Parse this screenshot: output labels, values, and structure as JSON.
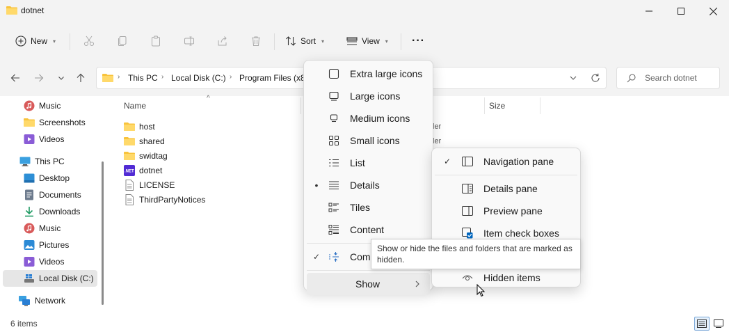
{
  "window": {
    "title": "dotnet"
  },
  "toolbar": {
    "new_label": "New",
    "sort_label": "Sort",
    "view_label": "View",
    "more_label": "···"
  },
  "address": {
    "crumbs": [
      "This PC",
      "Local Disk (C:)",
      "Program Files (x8"
    ],
    "search_placeholder": "Search dotnet"
  },
  "sidebar": {
    "items": [
      {
        "label": "Music",
        "icon": "music-icon",
        "indent": 1
      },
      {
        "label": "Screenshots",
        "icon": "folder-icon",
        "indent": 1
      },
      {
        "label": "Videos",
        "icon": "videos-icon",
        "indent": 1
      },
      {
        "label": "This PC",
        "icon": "computer-icon",
        "indent": 0
      },
      {
        "label": "Desktop",
        "icon": "desktop-icon",
        "indent": 1
      },
      {
        "label": "Documents",
        "icon": "documents-icon",
        "indent": 1
      },
      {
        "label": "Downloads",
        "icon": "downloads-icon",
        "indent": 1
      },
      {
        "label": "Music",
        "icon": "music-icon",
        "indent": 1
      },
      {
        "label": "Pictures",
        "icon": "pictures-icon",
        "indent": 1
      },
      {
        "label": "Videos",
        "icon": "videos-icon",
        "indent": 1
      },
      {
        "label": "Local Disk (C:)",
        "icon": "drive-icon",
        "indent": 1
      },
      {
        "label": "Network",
        "icon": "network-icon",
        "indent": 0
      }
    ]
  },
  "columns": {
    "name": "Name",
    "size": "Size"
  },
  "files": [
    {
      "name": "host",
      "icon": "folder-icon",
      "type": "ler"
    },
    {
      "name": "shared",
      "icon": "folder-icon",
      "type": "ler"
    },
    {
      "name": "swidtag",
      "icon": "folder-icon",
      "type": ""
    },
    {
      "name": "dotnet",
      "icon": "dotnet-exe-icon",
      "type": ""
    },
    {
      "name": "LICENSE",
      "icon": "document-icon",
      "type": ""
    },
    {
      "name": "ThirdPartyNotices",
      "icon": "document-icon",
      "type": ""
    }
  ],
  "status": {
    "item_count": "6 items"
  },
  "view_menu": {
    "items": [
      {
        "label": "Extra large icons",
        "icon": "extra-large-icons-icon",
        "mark": ""
      },
      {
        "label": "Large icons",
        "icon": "large-icons-icon",
        "mark": ""
      },
      {
        "label": "Medium icons",
        "icon": "medium-icons-icon",
        "mark": ""
      },
      {
        "label": "Small icons",
        "icon": "small-icons-icon",
        "mark": ""
      },
      {
        "label": "List",
        "icon": "list-icon",
        "mark": ""
      },
      {
        "label": "Details",
        "icon": "details-icon",
        "mark": "•"
      },
      {
        "label": "Tiles",
        "icon": "tiles-icon",
        "mark": ""
      },
      {
        "label": "Content",
        "icon": "content-icon",
        "mark": ""
      },
      {
        "label": "Com",
        "icon": "compact-icon",
        "mark": "✓"
      }
    ],
    "show_label": "Show"
  },
  "show_menu": {
    "items": [
      {
        "label": "Navigation pane",
        "icon": "navigation-pane-icon",
        "mark": "✓"
      },
      {
        "label": "Details pane",
        "icon": "details-pane-icon",
        "mark": ""
      },
      {
        "label": "Preview pane",
        "icon": "preview-pane-icon",
        "mark": ""
      },
      {
        "label": "Item check boxes",
        "icon": "item-check-boxes-icon",
        "mark": ""
      },
      {
        "label": "Hidden items",
        "icon": "hidden-items-icon",
        "mark": ""
      }
    ]
  },
  "tooltip": {
    "text": "Show or hide the files and folders that are marked as hidden."
  },
  "colors": {
    "accent": "#0067c0",
    "folder": "#f8c33c",
    "selection": "#e6e6e6"
  }
}
